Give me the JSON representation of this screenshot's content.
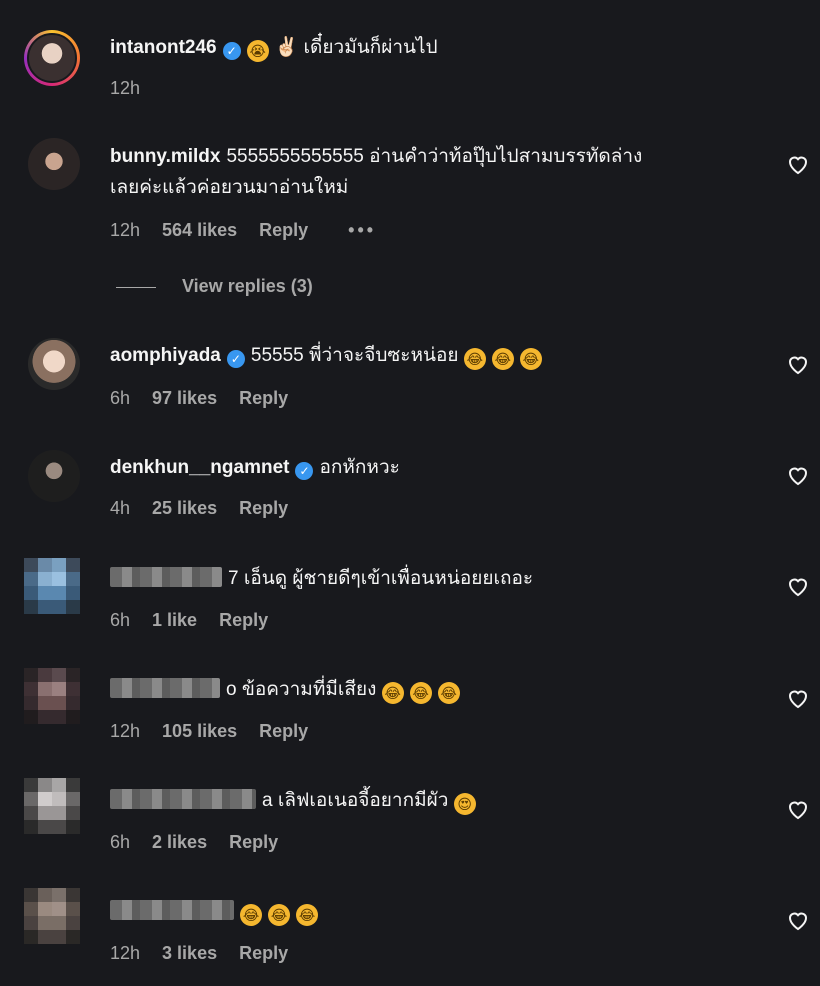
{
  "comments": [
    {
      "username": "intanont246",
      "verified": true,
      "text": "✌🏻 เดี๋ยวมันก็ผ่านไป",
      "time": "12h",
      "likes": "",
      "reply": "",
      "has_heart": false
    },
    {
      "username": "bunny.mildx",
      "verified": false,
      "text": "5555555555555 อ่านคำว่าท้อปุ๊บไปสามบรรทัดล่าง",
      "text2": "เลยค่ะแล้วค่อยวนมาอ่านใหม่",
      "time": "12h",
      "likes": "564 likes",
      "reply": "Reply",
      "more": "•••",
      "has_heart": true
    },
    {
      "username": "aomphiyada",
      "verified": true,
      "text": "55555 พี่ว่าจะจีบซะหน่อย",
      "time": "6h",
      "likes": "97 likes",
      "reply": "Reply",
      "has_heart": true
    },
    {
      "username": "denkhun__ngamnet",
      "verified": true,
      "text": "อกหักหวะ",
      "time": "4h",
      "likes": "25 likes",
      "reply": "Reply",
      "has_heart": true
    },
    {
      "username": "",
      "text": "7 เอ็นดู ผู้ชายดีๆเข้าเพื่อนหน่อยยเถอะ",
      "time": "6h",
      "likes": "1 like",
      "reply": "Reply",
      "has_heart": true
    },
    {
      "username": "",
      "text": "o ข้อความที่มีเสียง",
      "time": "12h",
      "likes": "105 likes",
      "reply": "Reply",
      "has_heart": true
    },
    {
      "username": "",
      "text": "a เลิฟเอเนอจี้อยากมีผัว",
      "time": "6h",
      "likes": "2 likes",
      "reply": "Reply",
      "has_heart": true
    },
    {
      "username": "",
      "text": "",
      "time": "12h",
      "likes": "3 likes",
      "reply": "Reply",
      "has_heart": true
    }
  ],
  "view_replies": "View replies (3)",
  "icons": {
    "heart": "heart-outline-icon",
    "verified": "verified-badge-icon",
    "emoji": "laughing-emoji-icon"
  }
}
